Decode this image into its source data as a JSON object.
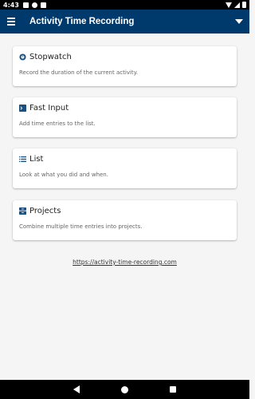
{
  "status_bar": {
    "time": "4:43"
  },
  "app_bar": {
    "title": "Activity Time Recording"
  },
  "cards": [
    {
      "title": "Stopwatch",
      "description": "Record the duration of the current activity.",
      "icon": "stopwatch-icon"
    },
    {
      "title": "Fast Input",
      "description": "Add time entries to the list.",
      "icon": "terminal-icon"
    },
    {
      "title": "List",
      "description": "Look at what you did and when.",
      "icon": "list-icon"
    },
    {
      "title": "Projects",
      "description": "Combine multiple time entries into projects.",
      "icon": "projects-icon"
    }
  ],
  "footer": {
    "link": "https://activity-time-recording.com"
  },
  "colors": {
    "app_bar": "#003a6d",
    "icon": "#1a4f7f"
  }
}
